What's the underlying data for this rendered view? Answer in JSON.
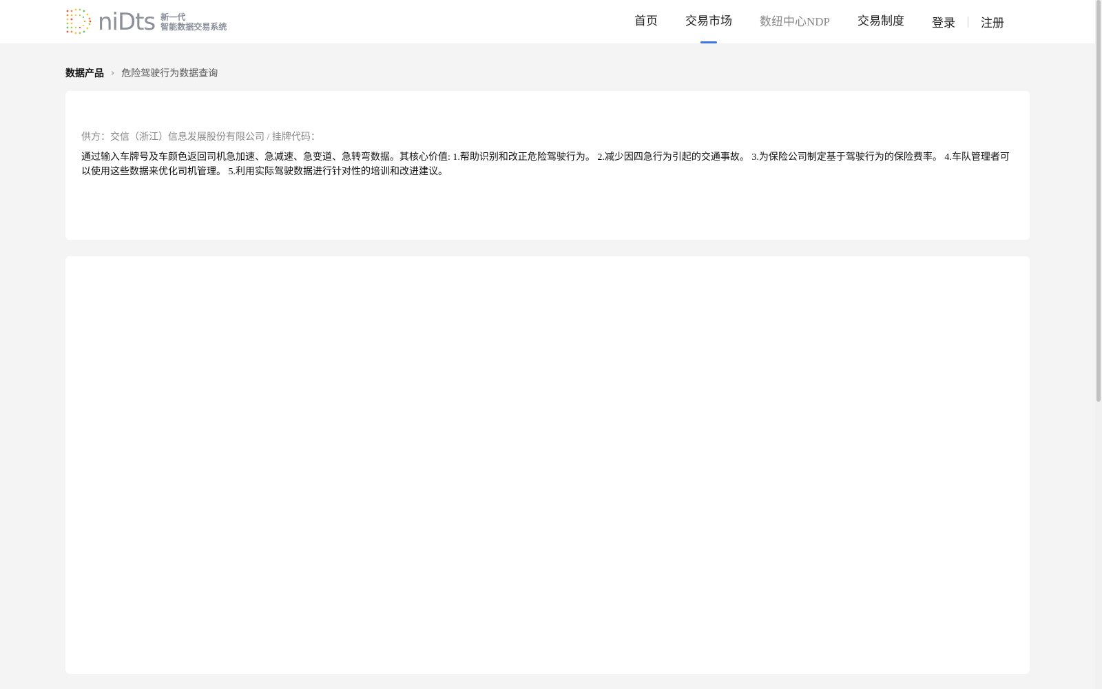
{
  "brand": {
    "wordmark": "niDts",
    "tagline_line1": "新一代",
    "tagline_line2": "智能数据交易系统"
  },
  "nav": {
    "items": [
      {
        "label": "首页"
      },
      {
        "label": "交易市场",
        "active": true
      },
      {
        "label": "数纽中心NDP"
      },
      {
        "label": "交易制度"
      }
    ],
    "login": "登录",
    "register": "注册",
    "accent_color": "#3b74e8"
  },
  "breadcrumb": {
    "root": "数据产品",
    "current": "危险驾驶行为数据查询"
  },
  "product": {
    "supplier_line": "供方：交信（浙江）信息发展股份有限公司 / 挂牌代码：",
    "description": "通过输入车牌号及车颜色返回司机急加速、急减速、急变道、急转弯数据。其核心价值: 1.帮助识别和改正危险驾驶行为。 2.减少因四急行为引起的交通事故。 3.为保险公司制定基于驾驶行为的保险费率。 4.车队管理者可以使用这些数据来优化司机管理。 5.利用实际驾驶数据进行针对性的培训和改进建议。"
  }
}
